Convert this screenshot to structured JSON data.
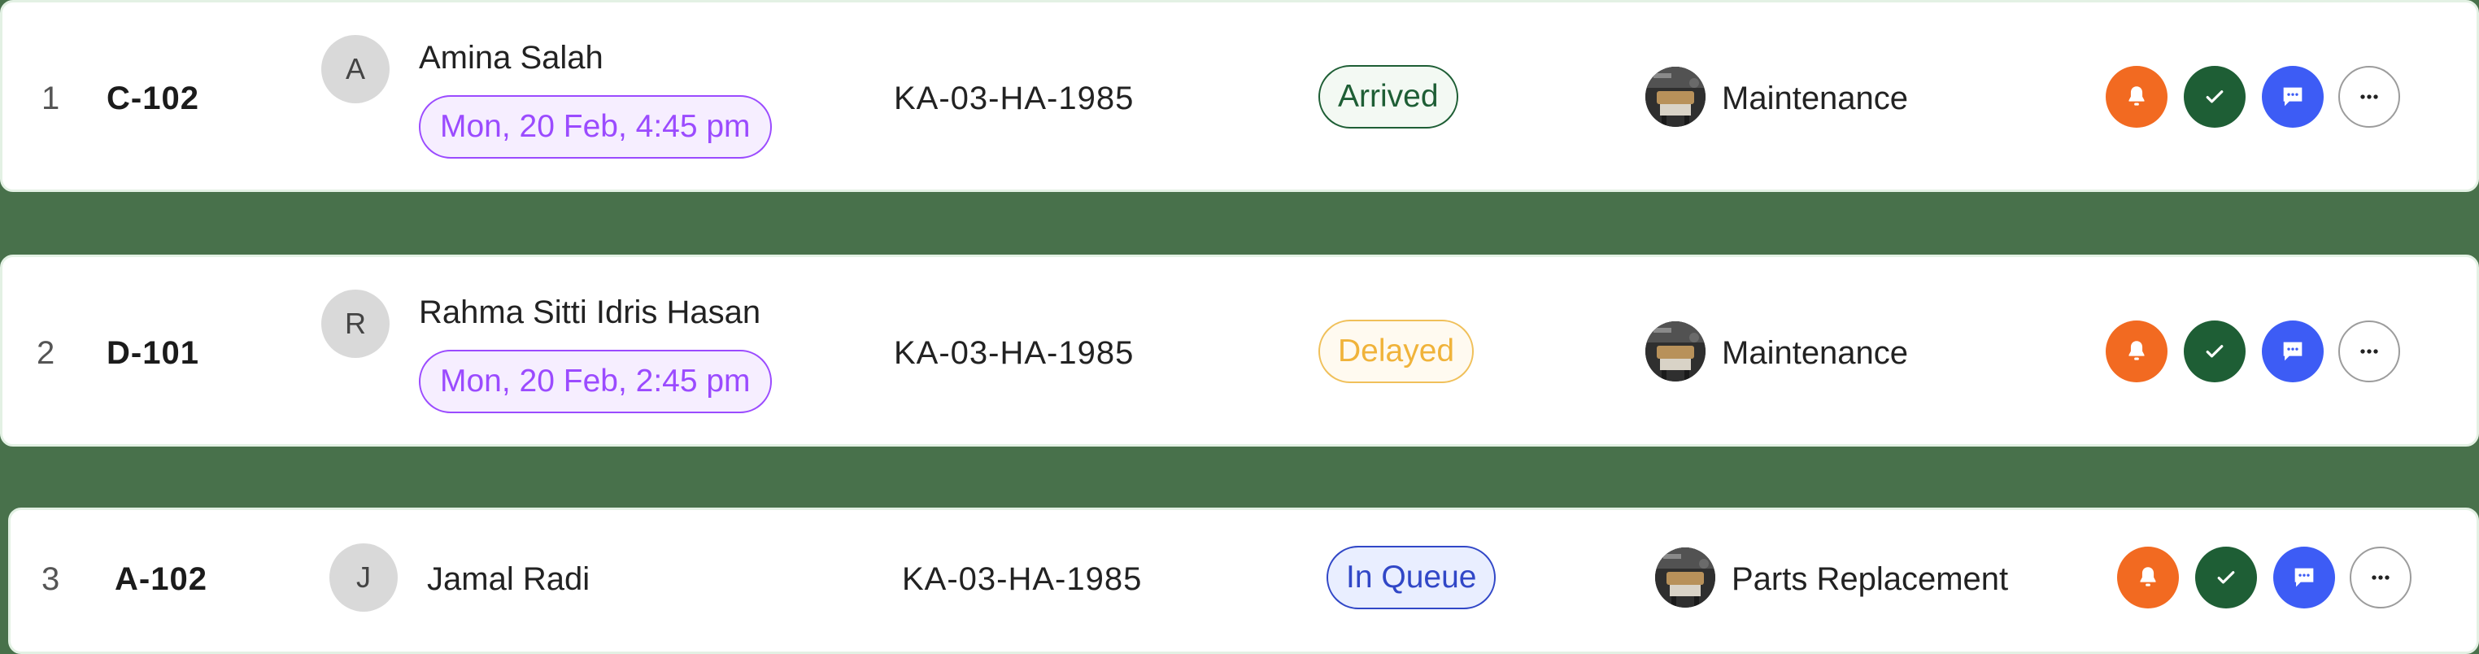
{
  "colors": {
    "background": "#48714b",
    "date_pill": "#9b4bff",
    "bell": "#f26a21",
    "check": "#1e5e35",
    "message": "#3d5cf5"
  },
  "rows": [
    {
      "index": "1",
      "code": "C-102",
      "avatar_initial": "A",
      "name": "Amina Salah",
      "date": "Mon, 20 Feb, 4:45 pm",
      "plate": "KA-03-HA-1985",
      "status": "Arrived",
      "status_colors": {
        "text": "#1e5e35",
        "border": "#1e5e35",
        "bg": "#f3f9f3"
      },
      "service": "Maintenance"
    },
    {
      "index": "2",
      "code": "D-101",
      "avatar_initial": "R",
      "name": "Rahma Sitti Idris Hasan",
      "date": "Mon, 20 Feb, 2:45 pm",
      "plate": "KA-03-HA-1985",
      "status": "Delayed",
      "status_colors": {
        "text": "#f0b33a",
        "border": "#f0c05a",
        "bg": "#fffaf0"
      },
      "service": "Maintenance"
    },
    {
      "index": "3",
      "code": "A-102",
      "avatar_initial": "J",
      "name": "Jamal Radi",
      "date": "",
      "plate": "KA-03-HA-1985",
      "status": "In Queue",
      "status_colors": {
        "text": "#3147c7",
        "border": "#3147c7",
        "bg": "#e9eeff"
      },
      "service": "Parts Replacement"
    }
  ],
  "actions": [
    {
      "name": "notify-button",
      "icon": "bell-icon"
    },
    {
      "name": "approve-button",
      "icon": "check-icon"
    },
    {
      "name": "message-button",
      "icon": "chat-icon"
    },
    {
      "name": "more-button",
      "icon": "more-horizontal-icon"
    }
  ]
}
